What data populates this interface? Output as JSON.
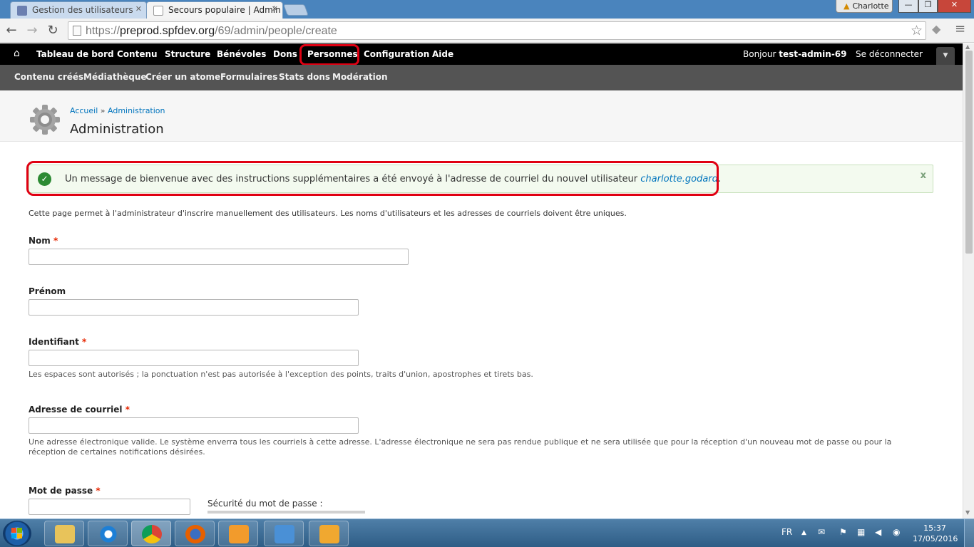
{
  "browser": {
    "tabs": [
      {
        "title": "Gestion des utilisateurs",
        "active": false
      },
      {
        "title": "Secours populaire | Admin",
        "active": true
      }
    ],
    "profile_name": "Charlotte",
    "window_buttons": {
      "minimize": "—",
      "maximize": "❐",
      "close": "✕"
    },
    "url_scheme": "https://",
    "url_host": "preprod.spfdev.org",
    "url_path": "/69/admin/people/create"
  },
  "admin_menu": {
    "items": [
      "Tableau de bord",
      "Contenu",
      "Structure",
      "Bénévoles",
      "Dons",
      "Personnes",
      "Configuration",
      "Aide"
    ],
    "greeting_prefix": "Bonjour",
    "username": "test-admin-69",
    "logout": "Se déconnecter",
    "highlighted_item": "Personnes"
  },
  "shortcuts": [
    "Contenu créés",
    "Médiathèque",
    "Créer un atome",
    "Formulaires",
    "Stats dons",
    "Modération"
  ],
  "header": {
    "breadcrumb_home": "Accueil",
    "breadcrumb_sep": "»",
    "breadcrumb_admin": "Administration",
    "title": "Administration"
  },
  "status_message": {
    "text": "Un message de bienvenue avec des instructions supplémentaires a été envoyé à l'adresse de courriel du nouvel utilisateur",
    "user_link": "charlotte.godard",
    "suffix": ".",
    "close": "x"
  },
  "intro": "Cette page permet à l'administrateur d'inscrire manuellement des utilisateurs. Les noms d'utilisateurs et les adresses de courriels doivent être uniques.",
  "form": {
    "required_mark": "*",
    "nom_label": "Nom",
    "prenom_label": "Prénom",
    "identifiant_label": "Identifiant",
    "identifiant_desc": "Les espaces sont autorisés ; la ponctuation n'est pas autorisée à l'exception des points, traits d'union, apostrophes et tirets bas.",
    "email_label": "Adresse de courriel",
    "email_desc": "Une adresse électronique valide. Le système enverra tous les courriels à cette adresse. L'adresse électronique ne sera pas rendue publique et ne sera utilisée que pour la réception d'un nouveau mot de passe ou pour la réception de certaines notifications désirées.",
    "password_label": "Mot de passe",
    "password_strength_label": "Sécurité du mot de passe :"
  },
  "taskbar": {
    "language": "FR",
    "time": "15:37",
    "date": "17/05/2016"
  },
  "colors": {
    "admin_bar": "#000000",
    "shortcut_bar": "#545454",
    "link": "#0074bd",
    "highlight": "#e00012",
    "success": "#2c8a33"
  }
}
